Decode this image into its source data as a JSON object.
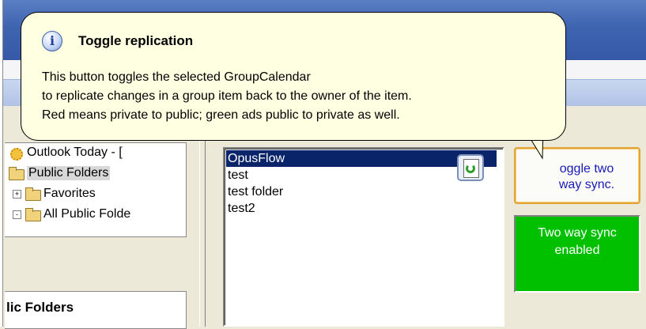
{
  "tooltip": {
    "title": "Toggle replication",
    "lines": [
      "This button toggles the selected GroupCalendar",
      "to replicate changes in a group item back to the owner of the item.",
      "Red means private to public; green ads public to private as well."
    ],
    "icon": "info-icon"
  },
  "folder_tree": {
    "items": [
      {
        "label": "Outlook Today - [",
        "icon": "outlook-today-icon"
      },
      {
        "label": "Public Folders",
        "icon": "public-folders-icon"
      },
      {
        "label": "Favorites",
        "icon": "favorites-folder-icon",
        "expander": "+"
      },
      {
        "label": "All Public Folde",
        "icon": "all-public-folders-icon",
        "expander": "-"
      }
    ]
  },
  "folder_section": {
    "title": "lic Folders"
  },
  "calendars": {
    "items": [
      "OpusFlow",
      "test",
      "test folder",
      "test2"
    ],
    "selected": "OpusFlow"
  },
  "toggle_button": {
    "label_line1": "oggle two",
    "label_line2": "way sync."
  },
  "status": {
    "line1": "Two way sync",
    "line2": "enabled",
    "color": "#00c000"
  },
  "colors": {
    "balloon_bg": "#ffffe1",
    "selection": "#0a246a",
    "accent_border": "#e0a43a"
  }
}
